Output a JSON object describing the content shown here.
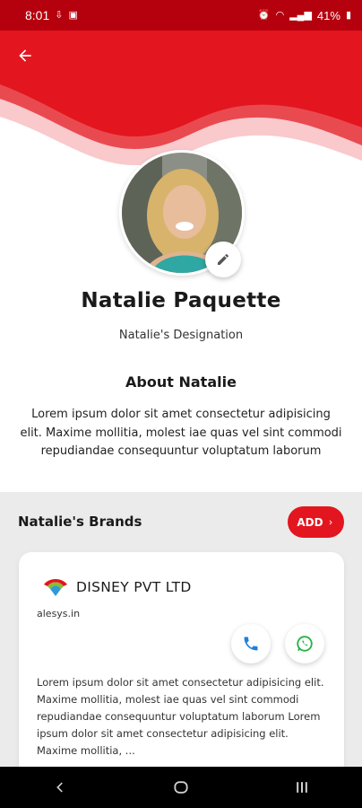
{
  "status_bar": {
    "time": "8:01",
    "battery": "41%"
  },
  "colors": {
    "brand_red": "#e3151e",
    "dark_red": "#b5000e"
  },
  "profile": {
    "name": "Natalie Paquette",
    "designation": "Natalie's Designation"
  },
  "about": {
    "title": "About Natalie",
    "text": "Lorem ipsum dolor sit amet consectetur adipisicing elit. Maxime mollitia, molest iae quas vel sint commodi repudiandae consequuntur voluptatum laborum"
  },
  "brands": {
    "title": "Natalie's Brands",
    "add_label": "ADD",
    "items": [
      {
        "name": "DISNEY PVT LTD",
        "url": "alesys.in",
        "description": "Lorem ipsum dolor sit amet consectetur adipisicing elit. Maxime mollitia, molest iae quas vel sint commodi repudiandae consequuntur voluptatum laborum Lorem ipsum dolor sit amet consectetur adipisicing elit. Maxime mollitia, ..."
      }
    ]
  },
  "icons": {
    "back": "arrow-left-icon",
    "edit": "pencil-icon",
    "call": "phone-icon",
    "whatsapp": "whatsapp-icon",
    "add": "chevron-right-icon"
  }
}
